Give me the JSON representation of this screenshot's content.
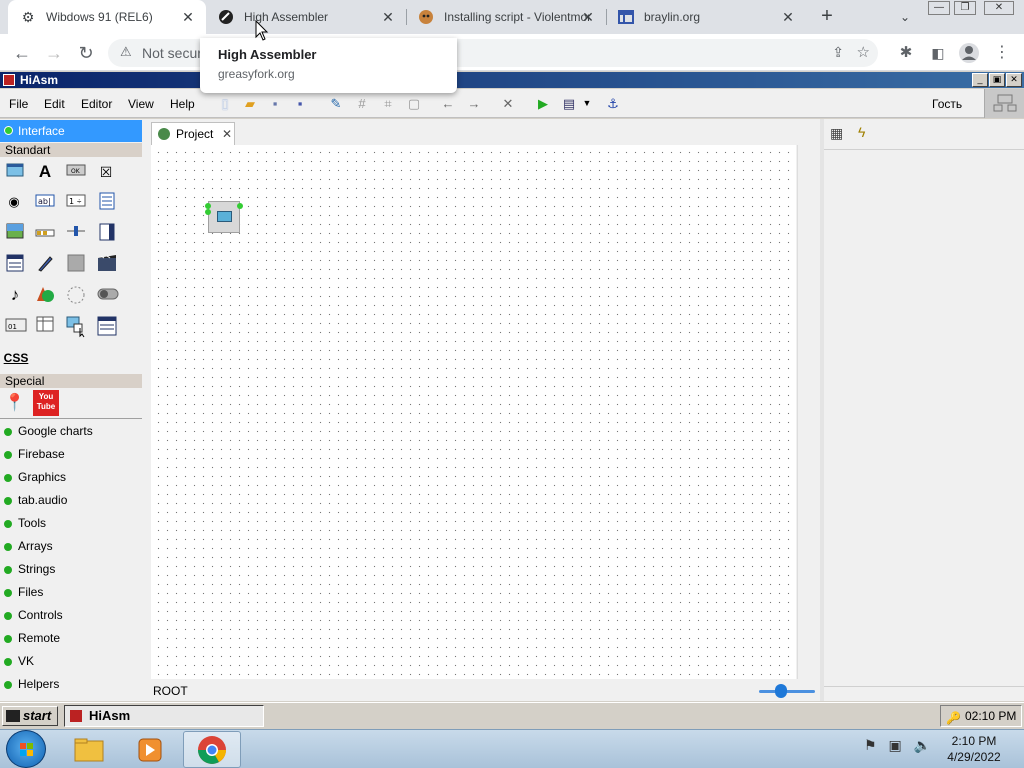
{
  "browser": {
    "tabs": [
      {
        "title": "Wibdows 91 (REL6)",
        "icon": "windows-logo-icon"
      },
      {
        "title": "High Assembler",
        "icon": "greasyfork-icon"
      },
      {
        "title": "Installing script - Violentmonkey",
        "icon": "violentmonkey-icon"
      },
      {
        "title": "braylin.org",
        "icon": "site-icon"
      }
    ],
    "tab_close": "✕",
    "new_tab": "+",
    "tab_search": "⌄",
    "window_controls": {
      "minimize": "—",
      "restore": "❐",
      "close": "✕"
    },
    "nav": {
      "back": "←",
      "forward": "→",
      "reload": "↻"
    },
    "omnibox": {
      "security_icon": "⚠",
      "text": "Not secure"
    },
    "tooltip": {
      "title": "High Assembler",
      "subtitle": "greasyfork.org"
    }
  },
  "app": {
    "title": "HiAsm",
    "title_controls": {
      "minimize": "_",
      "maximize": "▣",
      "close": "✕"
    },
    "menu": [
      "File",
      "Edit",
      "Editor",
      "View",
      "Help"
    ],
    "toolbar_icons": [
      "new-file-icon",
      "open-folder-icon",
      "save-icon",
      "save-as-icon",
      "edit-icon",
      "grid-icon",
      "align-icon",
      "frame-icon",
      "undo-icon",
      "redo-icon",
      "delete-icon",
      "run-icon",
      "compile-icon",
      "dropdown-icon",
      "anchor-icon"
    ],
    "guest_label": "Гость",
    "palette": {
      "header": "Interface",
      "section_standart": "Standart",
      "section_special": "Special",
      "css_label": "CSS",
      "youtube_label": "You Tube",
      "groups": [
        "Google charts",
        "Firebase",
        "Graphics",
        "tab.audio",
        "Tools",
        "Arrays",
        "Strings",
        "Files",
        "Controls",
        "Remote",
        "VK",
        "Helpers"
      ]
    },
    "editor": {
      "tab_label": "Project",
      "tab_close": "✕",
      "status_path": "ROOT"
    },
    "taskbar": {
      "start_label": "start",
      "task_label": "HiAsm",
      "clock": "02:10 PM"
    }
  },
  "os": {
    "clock_time": "2:10 PM",
    "clock_date": "4/29/2022"
  },
  "colors": {
    "title_bar": "#0a246a",
    "palette_header": "#3399ff",
    "group_dot": "#22aa22"
  }
}
